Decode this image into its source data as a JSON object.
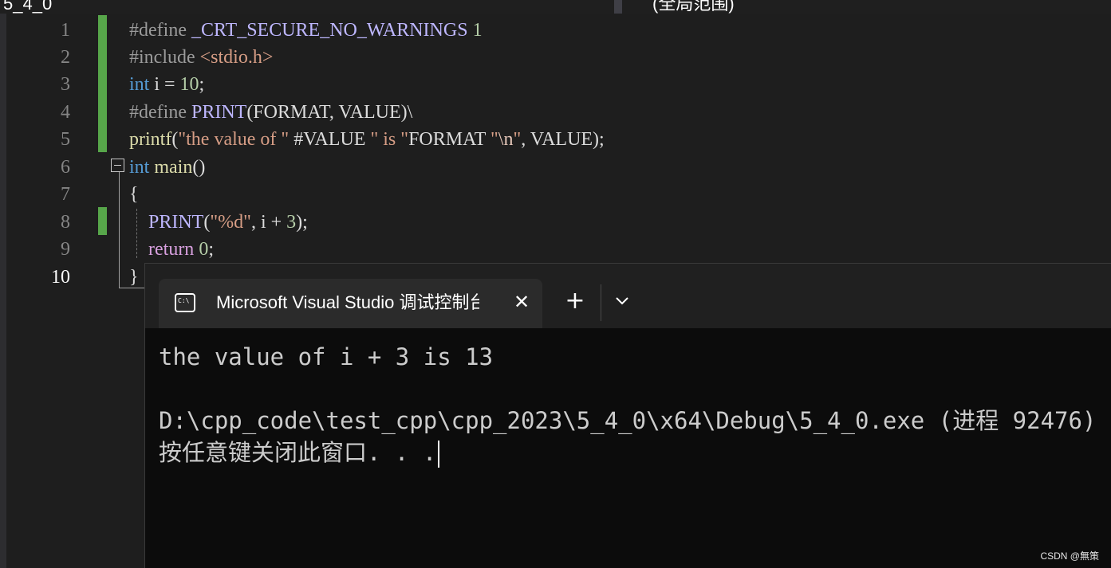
{
  "window": {
    "left_title": "5_4_0",
    "right_title": "(全局范围)"
  },
  "editor": {
    "line_numbers": [
      "1",
      "2",
      "3",
      "4",
      "5",
      "6",
      "7",
      "8",
      "9",
      "10"
    ],
    "current_line": "10",
    "lines": [
      [
        {
          "t": "#define ",
          "c": "pp"
        },
        {
          "t": "_CRT_SECURE_NO_WARNINGS",
          "c": "macro"
        },
        {
          "t": " ",
          "c": "id"
        },
        {
          "t": "1",
          "c": "num"
        }
      ],
      [
        {
          "t": "#include ",
          "c": "pp"
        },
        {
          "t": "<stdio.h>",
          "c": "str"
        }
      ],
      [
        {
          "t": "int",
          "c": "kw"
        },
        {
          "t": " i = ",
          "c": "id"
        },
        {
          "t": "10",
          "c": "num"
        },
        {
          "t": ";",
          "c": "id"
        }
      ],
      [
        {
          "t": "#define ",
          "c": "pp"
        },
        {
          "t": "PRINT",
          "c": "macro"
        },
        {
          "t": "(FORMAT, VALUE)\\",
          "c": "id"
        }
      ],
      [
        {
          "t": "printf",
          "c": "fn"
        },
        {
          "t": "(",
          "c": "id"
        },
        {
          "t": "\"the value of \"",
          "c": "str"
        },
        {
          "t": " #VALUE ",
          "c": "id"
        },
        {
          "t": "\" is \"",
          "c": "str"
        },
        {
          "t": "FORMAT ",
          "c": "id"
        },
        {
          "t": "\"",
          "c": "str"
        },
        {
          "t": "\\n",
          "c": "esc"
        },
        {
          "t": "\"",
          "c": "str"
        },
        {
          "t": ", VALUE);",
          "c": "id"
        }
      ],
      [
        {
          "t": "int",
          "c": "kw"
        },
        {
          "t": " ",
          "c": "id"
        },
        {
          "t": "main",
          "c": "fn"
        },
        {
          "t": "()",
          "c": "id"
        }
      ],
      [
        {
          "t": "{",
          "c": "id"
        }
      ],
      [
        {
          "t": "    ",
          "c": "id"
        },
        {
          "t": "PRINT",
          "c": "macro"
        },
        {
          "t": "(",
          "c": "id"
        },
        {
          "t": "\"%d\"",
          "c": "str"
        },
        {
          "t": ", i + ",
          "c": "id"
        },
        {
          "t": "3",
          "c": "num"
        },
        {
          "t": ");",
          "c": "id"
        }
      ],
      [
        {
          "t": "    ",
          "c": "id"
        },
        {
          "t": "return",
          "c": "kwc"
        },
        {
          "t": " ",
          "c": "id"
        },
        {
          "t": "0",
          "c": "num"
        },
        {
          "t": ";",
          "c": "id"
        }
      ],
      [
        {
          "t": "}",
          "c": "id"
        }
      ]
    ]
  },
  "console": {
    "tab_title": "Microsoft Visual Studio 调试控制台",
    "tab_icon_text": "C:\\",
    "close_glyph": "✕",
    "new_tab_glyph": "+",
    "output_lines": [
      "the value of i + 3 is 13",
      "",
      "D:\\cpp_code\\test_cpp\\cpp_2023\\5_4_0\\x64\\Debug\\5_4_0.exe (进程 92476)",
      "按任意键关闭此窗口. . ."
    ]
  },
  "watermark": "CSDN @無策",
  "colors": {
    "editor_bg": "#1e1e1e",
    "change_bar": "#57a64a",
    "console_bg": "#0c0c0c",
    "tab_bg": "#2b2b2b"
  }
}
